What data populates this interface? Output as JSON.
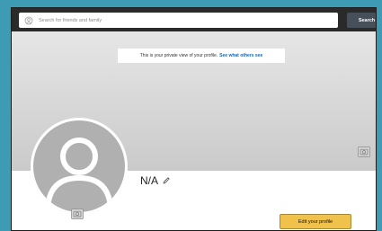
{
  "search": {
    "placeholder": "Search for friends and family",
    "button_label": "Search"
  },
  "notice": {
    "text": "This is your private view of your profile.",
    "link_label": "See what others see"
  },
  "profile": {
    "name": "N/A",
    "edit_button_label": "Edit your profile"
  },
  "icons": {
    "search": "search-icon",
    "camera": "camera-icon",
    "avatar": "default-avatar-icon",
    "edit": "pencil-icon"
  },
  "colors": {
    "background": "#3e9bb4",
    "edit_button": "#f0c14b",
    "link": "#1967b3"
  }
}
